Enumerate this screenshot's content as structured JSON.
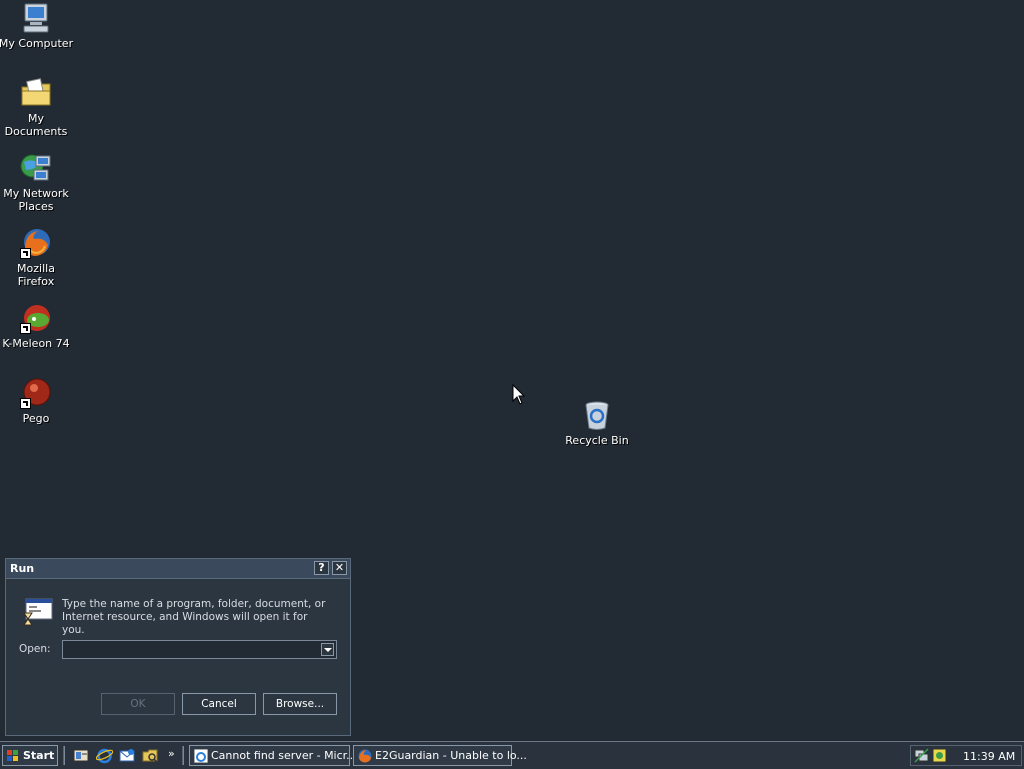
{
  "desktop": {
    "icons": [
      {
        "label": "My Computer",
        "icon": "computer-icon"
      },
      {
        "label": "My Documents",
        "icon": "documents-folder-icon"
      },
      {
        "label": "My Network Places",
        "icon": "network-places-icon"
      },
      {
        "label": "Mozilla Firefox",
        "icon": "firefox-icon"
      },
      {
        "label": "K-Meleon 74",
        "icon": "k-meleon-icon"
      },
      {
        "label": "Pego",
        "icon": "pego-icon"
      },
      {
        "label": "Recycle Bin",
        "icon": "recycle-bin-icon"
      }
    ]
  },
  "run_dialog": {
    "title": "Run",
    "help_label": "?",
    "close_label": "✕",
    "description": "Type the name of a program, folder, document, or Internet resource, and Windows will open it for you.",
    "open_label": "Open:",
    "open_value": "",
    "ok_label": "OK",
    "cancel_label": "Cancel",
    "browse_label": "Browse..."
  },
  "taskbar": {
    "start_label": "Start",
    "quick_launch": [
      {
        "icon": "show-desktop-icon"
      },
      {
        "icon": "internet-explorer-icon"
      },
      {
        "icon": "outlook-express-icon"
      },
      {
        "icon": "windows-explorer-icon"
      }
    ],
    "more_label": "»",
    "tasks": [
      {
        "label": "Cannot find server - Micr...",
        "icon": "internet-explorer-icon"
      },
      {
        "label": "E2Guardian - Unable to lo...",
        "icon": "firefox-icon"
      }
    ],
    "clock": "11:39 AM"
  }
}
